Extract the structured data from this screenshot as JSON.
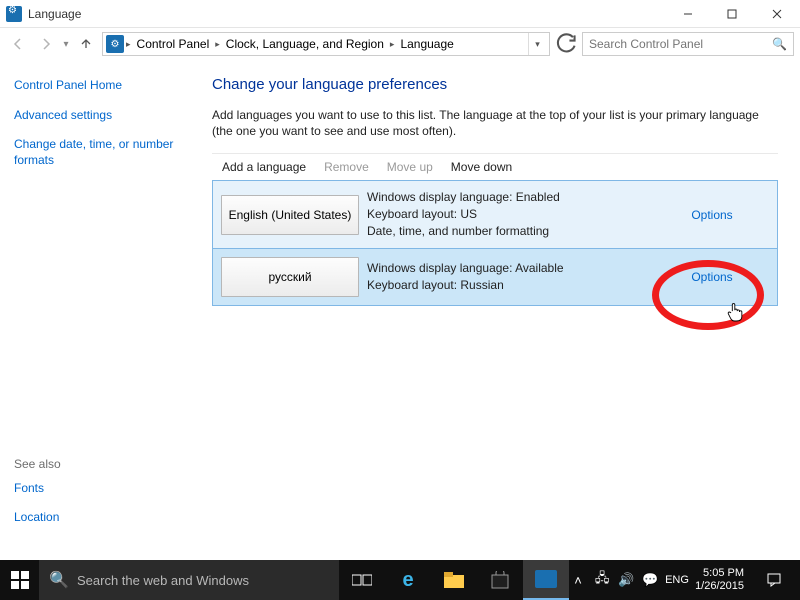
{
  "window": {
    "title": "Language"
  },
  "breadcrumb": {
    "parts": [
      "Control Panel",
      "Clock, Language, and Region",
      "Language"
    ]
  },
  "search": {
    "placeholder": "Search Control Panel"
  },
  "leftnav": {
    "home": "Control Panel Home",
    "advanced": "Advanced settings",
    "dateformats": "Change date, time, or number formats",
    "seealso_title": "See also",
    "fonts": "Fonts",
    "location": "Location"
  },
  "main": {
    "heading": "Change your language preferences",
    "description": "Add languages you want to use to this list. The language at the top of your list is your primary language (the one you want to see and use most often).",
    "toolbar": {
      "add": "Add a language",
      "remove": "Remove",
      "moveup": "Move up",
      "movedown": "Move down"
    },
    "langs": [
      {
        "name": "English (United States)",
        "info": "Windows display language: Enabled\nKeyboard layout: US\nDate, time, and number formatting",
        "options": "Options"
      },
      {
        "name": "русский",
        "info": "Windows display language: Available\nKeyboard layout: Russian",
        "options": "Options"
      }
    ]
  },
  "taskbar": {
    "search": "Search the web and Windows",
    "lang": "ENG",
    "time": "5:05 PM",
    "date": "1/26/2015"
  }
}
